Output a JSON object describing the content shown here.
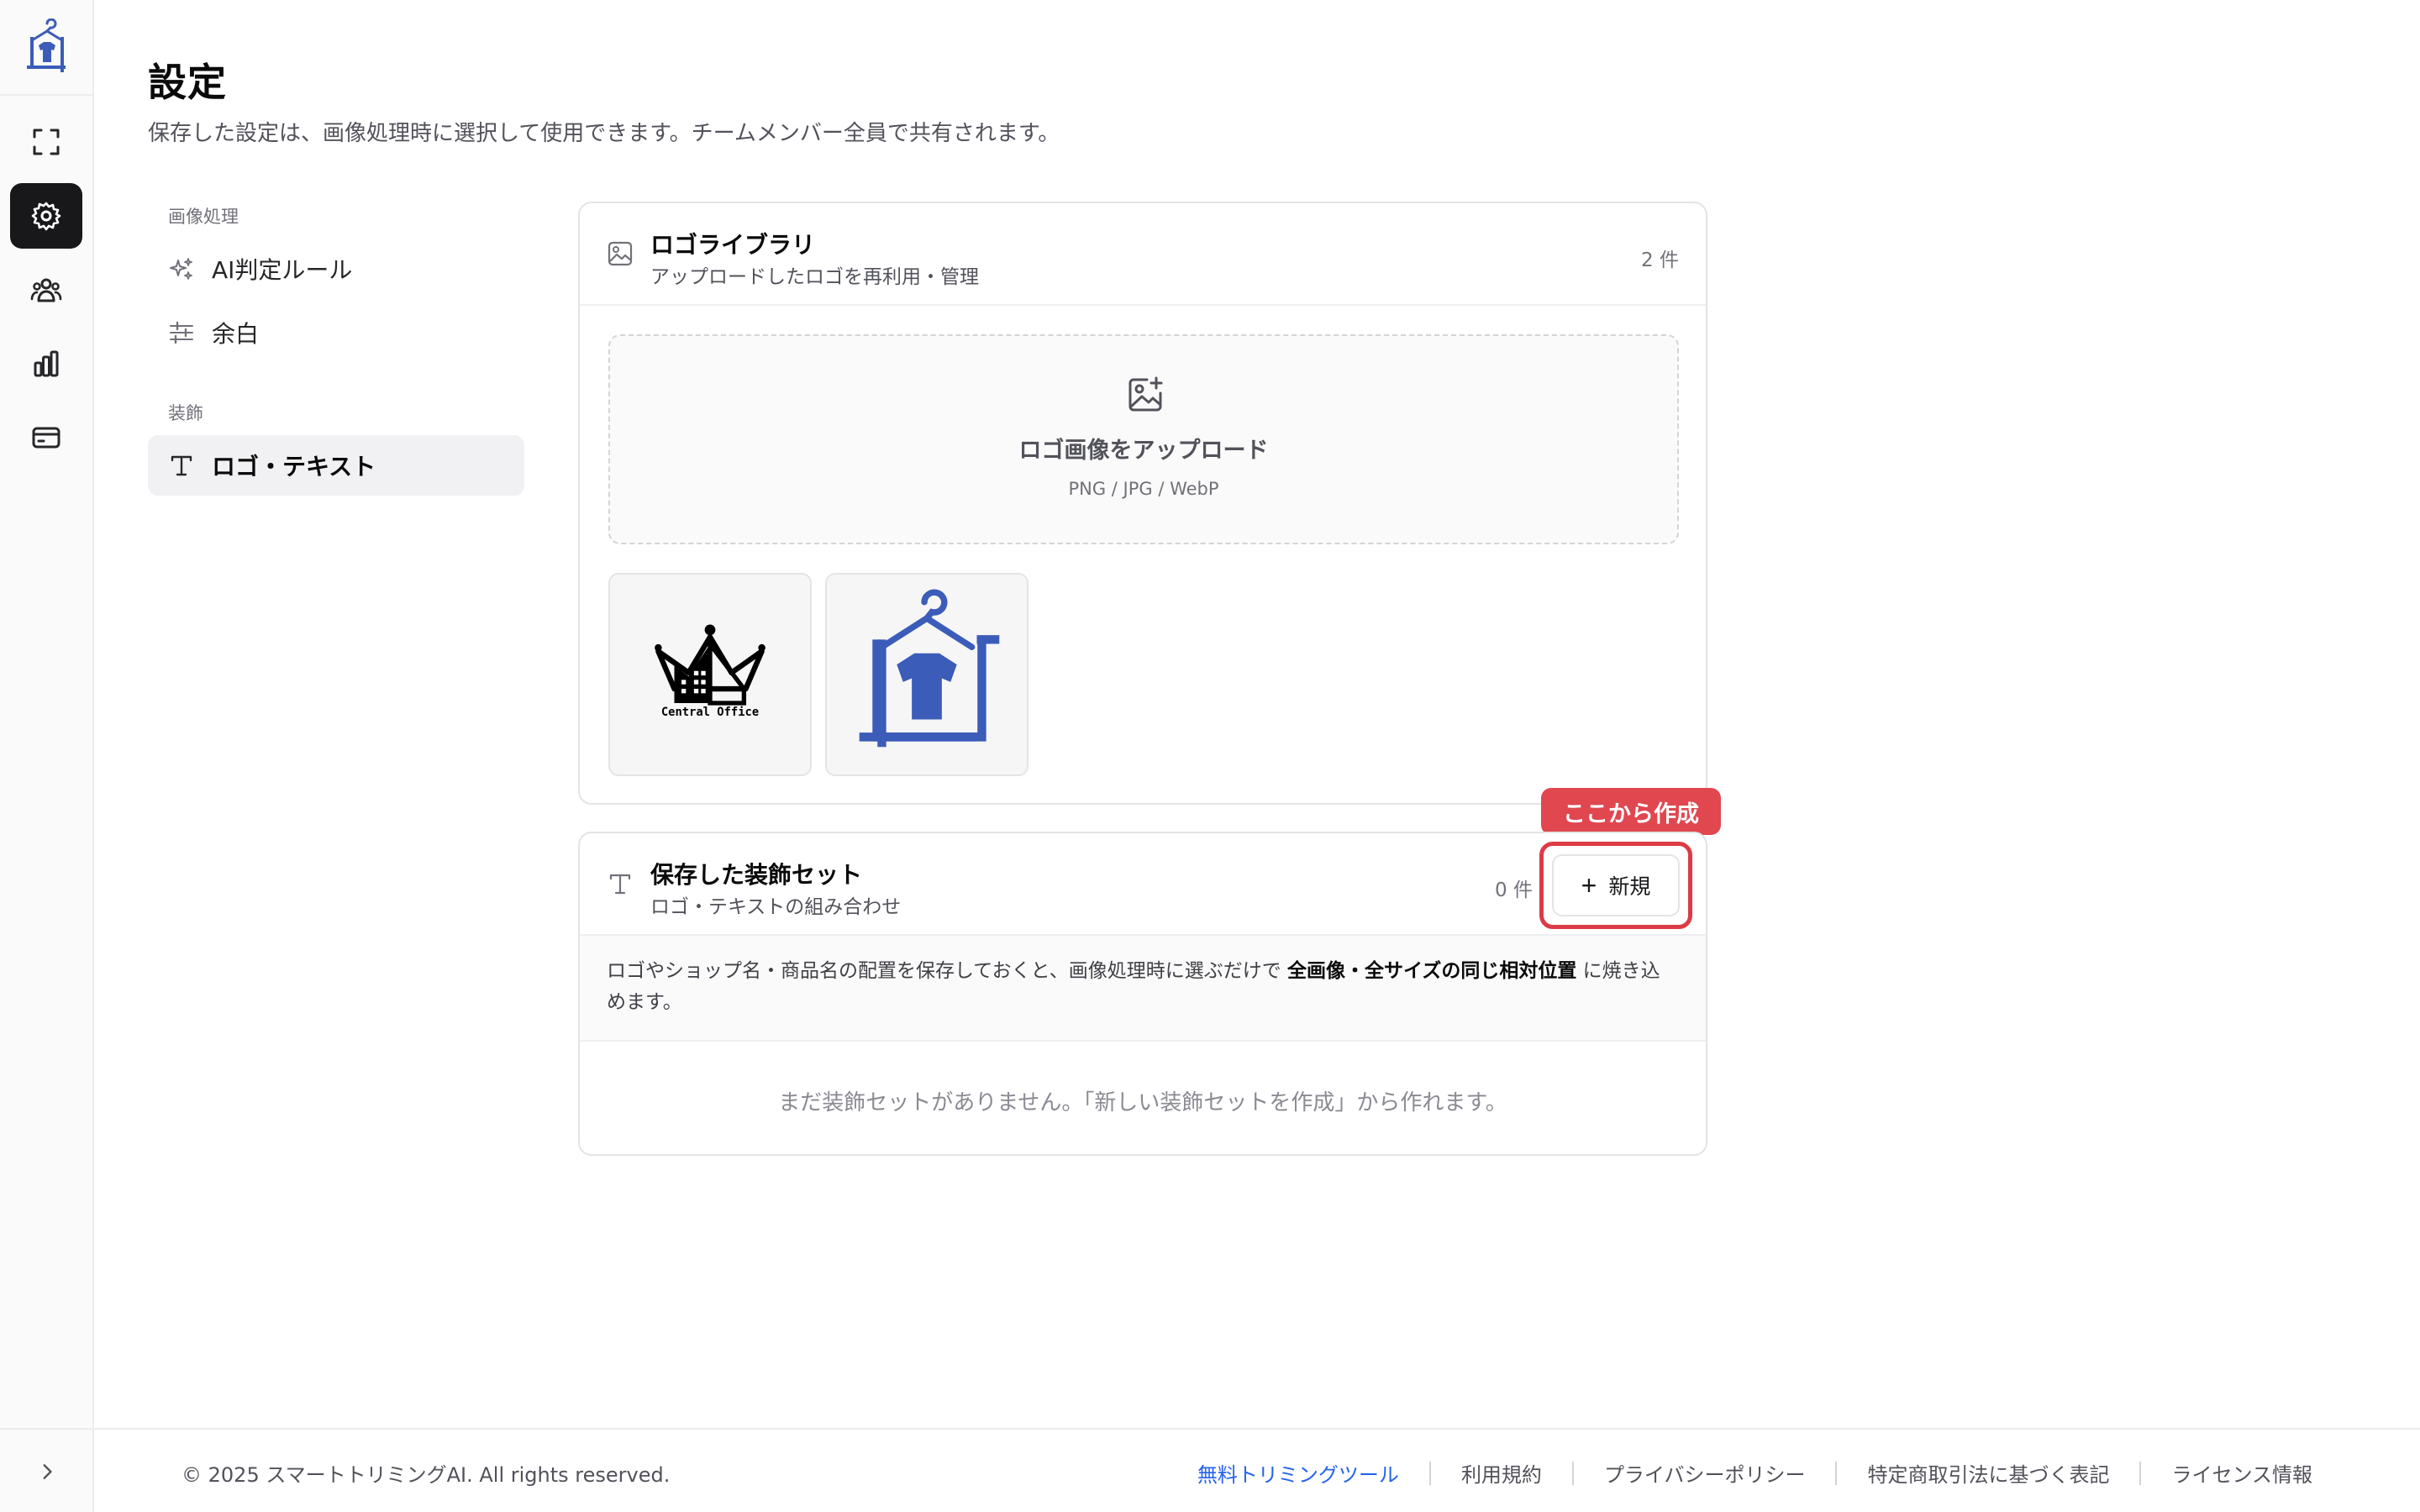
{
  "rail": {
    "items": [
      {
        "name": "crop",
        "icon": "crop-frame-icon"
      },
      {
        "name": "settings",
        "icon": "gear-icon",
        "active": true
      },
      {
        "name": "team",
        "icon": "users-icon"
      },
      {
        "name": "analytics",
        "icon": "bar-chart-icon"
      },
      {
        "name": "billing",
        "icon": "credit-card-icon"
      }
    ],
    "expand_icon": "chevron-right-icon"
  },
  "header": {
    "title": "設定",
    "subtitle": "保存した設定は、画像処理時に選択して使用できます。チームメンバー全員で共有されます。"
  },
  "subnav": {
    "group1": "画像処理",
    "item_ai": "AI判定ルール",
    "item_margin": "余白",
    "group2": "装飾",
    "item_logo_text": "ロゴ・テキスト"
  },
  "logo_library": {
    "title": "ロゴライブラリ",
    "subtitle": "アップロードしたロゴを再利用・管理",
    "count": "2 件",
    "upload_label": "ロゴ画像をアップロード",
    "upload_hint": "PNG / JPG / WebP",
    "logos": [
      {
        "name": "central-office-logo",
        "caption": "Central Office"
      },
      {
        "name": "hanger-tshirt-logo"
      }
    ]
  },
  "decor_sets": {
    "title": "保存した装飾セット",
    "subtitle": "ロゴ・テキストの組み合わせ",
    "count": "0 件",
    "new_button": "新規",
    "callout": "ここから作成",
    "desc_before": "ロゴやショップ名・商品名の配置を保存しておくと、画像処理時に選ぶだけで ",
    "desc_bold": "全画像・全サイズの同じ相対位置",
    "desc_after": " に焼き込めます。",
    "empty": "まだ装飾セットがありません。「新しい装飾セットを作成」から作れます。"
  },
  "footer": {
    "copyright": "© 2025 スマートトリミングAI. All rights reserved.",
    "links": [
      "無料トリミングツール",
      "利用規約",
      "プライバシーポリシー",
      "特定商取引法に基づく表記",
      "ライセンス情報"
    ]
  },
  "colors": {
    "accent_red": "#dc3b45",
    "brand_blue": "#3b5cb8",
    "link_blue": "#2563eb",
    "active_nav": "#18181b"
  }
}
